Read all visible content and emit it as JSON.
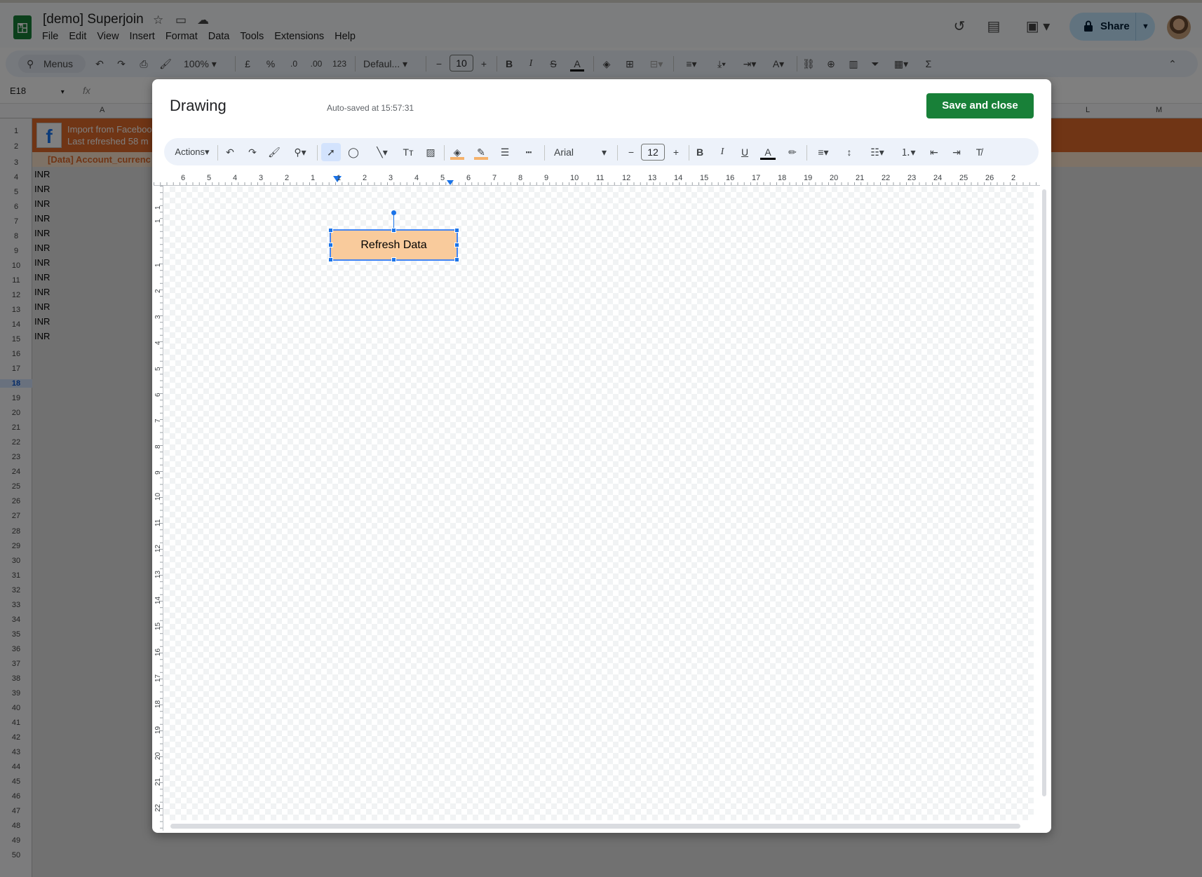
{
  "app": {
    "doc_title": "[demo] Superjoin",
    "menus": [
      "File",
      "Edit",
      "View",
      "Insert",
      "Format",
      "Data",
      "Tools",
      "Extensions",
      "Help"
    ],
    "share_label": "Share"
  },
  "toolbar": {
    "search_label": "Menus",
    "zoom": "100%",
    "currency": "£",
    "percent": "%",
    "dec_decrease": ".0",
    "dec_increase": ".00",
    "number_format": "123",
    "font": "Defaul...",
    "font_size": "10"
  },
  "formula_bar": {
    "name_box": "E18",
    "fx": "fx"
  },
  "sheet": {
    "columns": [
      "A",
      "L",
      "M"
    ],
    "row1_line1": "Import from Faceboo",
    "row1_line2": "Last refreshed 58 m",
    "row2": "[Data] Account_currenc",
    "values": [
      "INR",
      "INR",
      "INR",
      "INR",
      "INR",
      "INR",
      "INR",
      "INR",
      "INR",
      "INR",
      "INR",
      "INR"
    ],
    "rows": [
      "1",
      "2",
      "3",
      "4",
      "5",
      "6",
      "7",
      "8",
      "9",
      "10",
      "11",
      "12",
      "13",
      "14",
      "15",
      "16",
      "17",
      "18",
      "19",
      "20",
      "21",
      "22",
      "23",
      "24",
      "25",
      "26",
      "27",
      "28",
      "29",
      "30",
      "31",
      "32",
      "33",
      "34",
      "35",
      "36",
      "37",
      "38",
      "39",
      "40",
      "41",
      "42",
      "43",
      "44",
      "45",
      "46",
      "47",
      "48",
      "49",
      "50"
    ],
    "active_row": "18",
    "colors": {
      "header_fill": "#e06b2b",
      "row2_fill": "#fce5cd"
    }
  },
  "drawing": {
    "title": "Drawing",
    "autosave": "Auto-saved at 15:57:31",
    "save_label": "Save and close",
    "actions_label": "Actions",
    "font": "Arial",
    "font_size": "12",
    "shape_text": "Refresh Data",
    "ruler_h": [
      "6",
      "5",
      "4",
      "3",
      "2",
      "1",
      "1",
      "2",
      "3",
      "4",
      "5",
      "6",
      "7",
      "8",
      "9",
      "10",
      "11",
      "12",
      "13",
      "14",
      "15",
      "16",
      "17",
      "18",
      "19",
      "20",
      "21",
      "22",
      "23",
      "24",
      "25",
      "26",
      "2"
    ],
    "ruler_v": [
      "1",
      "1",
      "1",
      "2",
      "3",
      "4",
      "5",
      "6",
      "7",
      "8",
      "9",
      "10",
      "11",
      "12",
      "13",
      "14",
      "15",
      "16",
      "17",
      "18",
      "19",
      "20",
      "21",
      "22"
    ],
    "colors": {
      "shape_fill": "#f9cb9c",
      "selection": "#1a73e8",
      "save_button": "#188038"
    }
  }
}
